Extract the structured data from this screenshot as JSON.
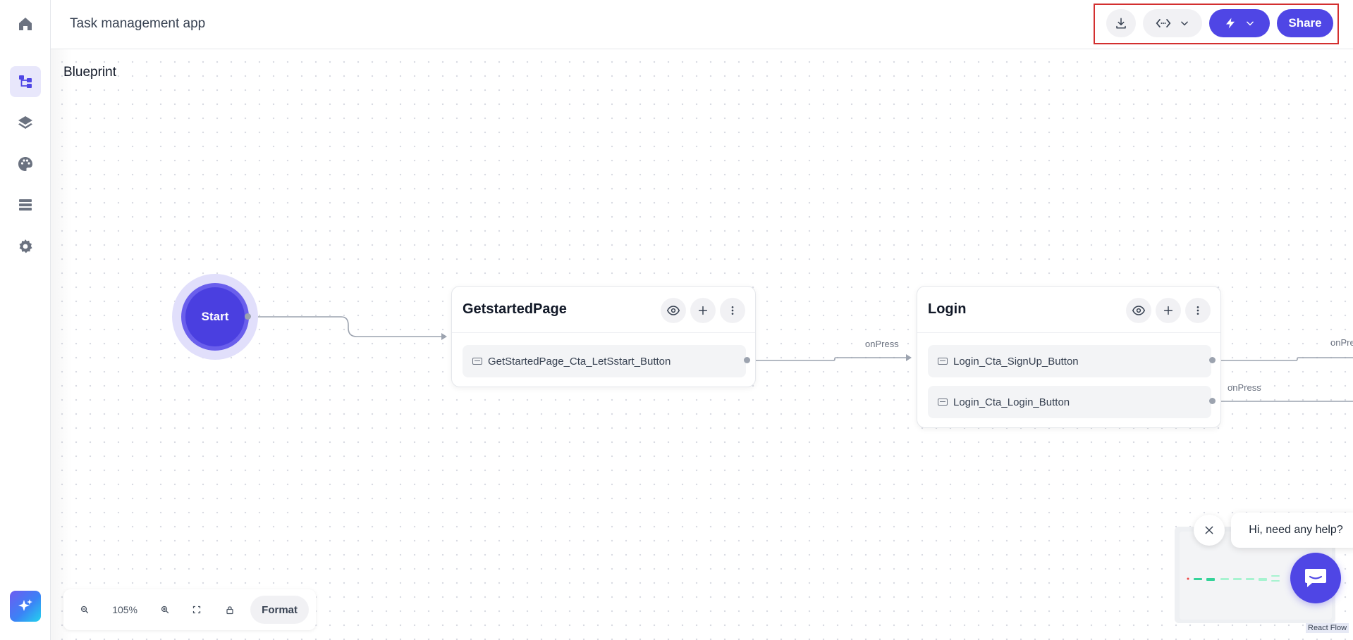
{
  "app": {
    "title": "Task management app"
  },
  "sidebar": {
    "items": [
      {
        "name": "home-icon"
      },
      {
        "name": "blueprint-icon",
        "active": true
      },
      {
        "name": "layers-icon"
      },
      {
        "name": "palette-icon"
      },
      {
        "name": "data-list-icon"
      },
      {
        "name": "settings-icon"
      }
    ],
    "ai_button_icon": "sparkle-icon"
  },
  "toolbar": {
    "download_icon": "download-icon",
    "code_icon": "code-icon",
    "bolt_icon": "lightning-icon",
    "share_label": "Share"
  },
  "canvas": {
    "title": "Blueprint",
    "start_label": "Start",
    "edge_labels": [
      "onPress",
      "onPress",
      "onPress"
    ],
    "nodes": [
      {
        "title": "GetstartedPage",
        "rows": [
          "GetStartedPage_Cta_LetSstart_Button"
        ]
      },
      {
        "title": "Login",
        "rows": [
          "Login_Cta_SignUp_Button",
          "Login_Cta_Login_Button"
        ]
      }
    ]
  },
  "zoom": {
    "level": "105%",
    "format_label": "Format"
  },
  "minimap": {
    "attribution": "React Flow"
  },
  "chat": {
    "prompt": "Hi, need any help?"
  },
  "colors": {
    "accent": "#4f46e5",
    "highlight": "#d32f2f"
  }
}
